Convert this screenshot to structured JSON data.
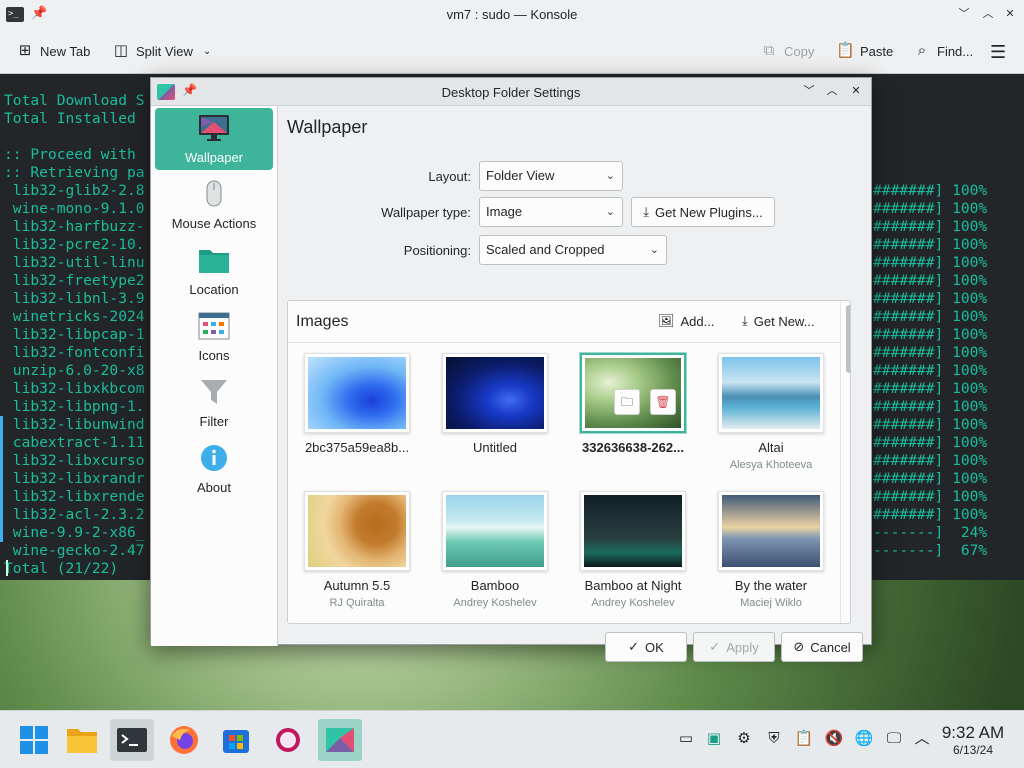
{
  "konsole": {
    "title": "vm7 : sudo — Konsole",
    "toolbar": {
      "new_tab": "New Tab",
      "split_view": "Split View",
      "copy": "Copy",
      "paste": "Paste",
      "find": "Find..."
    },
    "terminal_left": "Total Download S\nTotal Installed \n\n:: Proceed with \n:: Retrieving pa\n lib32-glib2-2.8\n wine-mono-9.1.0\n lib32-harfbuzz-\n lib32-pcre2-10.\n lib32-util-linu\n lib32-freetype2\n lib32-libnl-3.9\n winetricks-2024\n lib32-libpcap-1\n lib32-fontconfi\n unzip-6.0-20-x8\n lib32-libxkbcom\n lib32-libpng-1.\n lib32-libunwind\n cabextract-1.11\n lib32-libxcurso\n lib32-libxrandr\n lib32-libxrende\n lib32-acl-2.3.2\n wine-9.9-2-x86_\n wine-gecko-2.47\nTotal (21/22)",
    "terminal_right": "#######] 100%\n#######] 100%\n#######] 100%\n#######] 100%\n#######] 100%\n#######] 100%\n#######] 100%\n#######] 100%\n#######] 100%\n#######] 100%\n#######] 100%\n#######] 100%\n#######] 100%\n#######] 100%\n#######] 100%\n#######] 100%\n#######] 100%\n#######] 100%\n#######] 100%\n-------]  24%\n-------]  67%"
  },
  "dialog": {
    "title": "Desktop Folder Settings",
    "sidebar": [
      {
        "label": "Wallpaper",
        "icon": "monitor-icon"
      },
      {
        "label": "Mouse Actions",
        "icon": "mouse-icon"
      },
      {
        "label": "Location",
        "icon": "folder-icon"
      },
      {
        "label": "Icons",
        "icon": "icons-grid-icon"
      },
      {
        "label": "Filter",
        "icon": "funnel-icon"
      },
      {
        "label": "About",
        "icon": "info-icon"
      }
    ],
    "heading": "Wallpaper",
    "form": {
      "layout_label": "Layout:",
      "layout_value": "Folder View",
      "type_label": "Wallpaper type:",
      "type_value": "Image",
      "get_plugins": "Get New Plugins...",
      "positioning_label": "Positioning:",
      "positioning_value": "Scaled and Cropped"
    },
    "images": {
      "title": "Images",
      "add": "Add...",
      "get_new": "Get New...",
      "tiles": [
        {
          "name": "2bc375a59ea8b...",
          "author": ""
        },
        {
          "name": "Untitled",
          "author": ""
        },
        {
          "name": "332636638-262...",
          "author": ""
        },
        {
          "name": "Altai",
          "author": "Alesya Khoteeva"
        },
        {
          "name": "Autumn 5.5",
          "author": "RJ Quiralta"
        },
        {
          "name": "Bamboo",
          "author": "Andrey Koshelev"
        },
        {
          "name": "Bamboo at Night",
          "author": "Andrey Koshelev"
        },
        {
          "name": "By the water",
          "author": "Maciej Wiklo"
        }
      ]
    },
    "footer": {
      "ok": "OK",
      "apply": "Apply",
      "cancel": "Cancel"
    }
  },
  "clock": {
    "time": "9:32 AM",
    "date": "6/13/24"
  },
  "colors": {
    "accent": "#3eb49b",
    "terminal_text": "#1abc9c",
    "terminal_bg": "#232629"
  }
}
